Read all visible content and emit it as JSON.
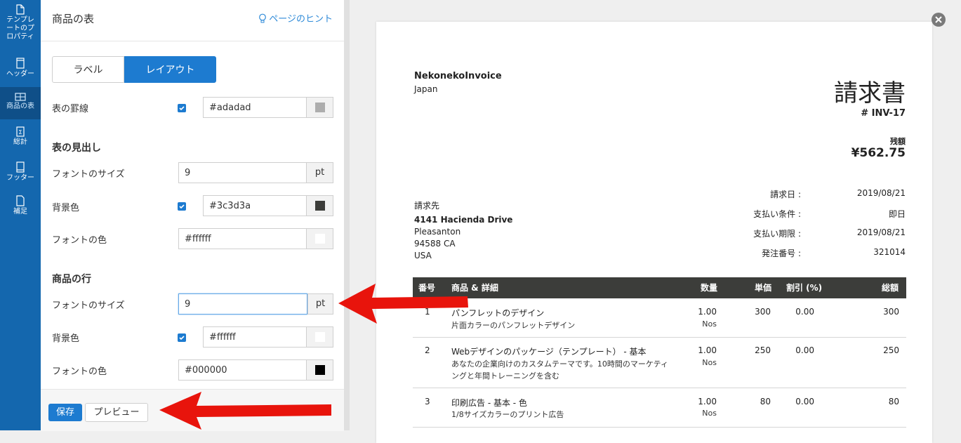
{
  "rail": {
    "items": [
      {
        "label_lines": [
          "テンプレ",
          "ートのプ",
          "ロパティ"
        ]
      },
      {
        "label_lines": [
          "ヘッダー"
        ]
      },
      {
        "label_lines": [
          "商品の表"
        ]
      },
      {
        "label_lines": [
          "総計"
        ]
      },
      {
        "label_lines": [
          "フッター"
        ]
      },
      {
        "label_lines": [
          "補足"
        ]
      }
    ],
    "active_index": 2
  },
  "panel": {
    "title": "商品の表",
    "hint": "ページのヒント",
    "tabs": [
      "ラベル",
      "レイアウト"
    ],
    "active_tab": "レイアウト",
    "border": {
      "label": "表の罫線",
      "checked": true,
      "color": "#adadad"
    },
    "header_section": {
      "title": "表の見出し",
      "font_size_label": "フォントのサイズ",
      "font_size": "9",
      "unit": "pt",
      "bg_label": "背景色",
      "bg_checked": true,
      "bg_color": "#3c3d3a",
      "font_color_label": "フォントの色",
      "font_color": "#ffffff"
    },
    "row_section": {
      "title": "商品の行",
      "font_size_label": "フォントのサイズ",
      "font_size": "9",
      "unit": "pt",
      "bg_label": "背景色",
      "bg_checked": true,
      "bg_color": "#ffffff",
      "font_color_label": "フォントの色",
      "font_color": "#000000"
    },
    "footer": {
      "save": "保存",
      "preview": "プレビュー"
    }
  },
  "invoice": {
    "company": "NekonekoInvoice",
    "country": "Japan",
    "doc_title": "請求書",
    "number": "# INV-17",
    "balance_label": "残額",
    "balance": "¥562.75",
    "bill_to_label": "請求先",
    "bill_to": {
      "line1": "4141 Hacienda Drive",
      "line2": "Pleasanton",
      "line3": "94588 CA",
      "line4": "USA"
    },
    "meta": [
      {
        "label": "請求日 :",
        "value": "2019/08/21"
      },
      {
        "label": "支払い条件 :",
        "value": "即日"
      },
      {
        "label": "支払い期限 :",
        "value": "2019/08/21"
      },
      {
        "label": "発注番号 :",
        "value": "321014"
      }
    ],
    "table": {
      "headers": {
        "no": "番号",
        "item": "商品 & 詳細",
        "qty": "数量",
        "price": "単価",
        "discount": "割引 (%)",
        "total": "総額"
      },
      "rows": [
        {
          "no": "1",
          "name": "パンフレットのデザイン",
          "desc": [
            "片面カラーのパンフレットデザイン"
          ],
          "qty": "1.00",
          "unit": "Nos",
          "price": "300",
          "discount": "0.00",
          "total": "300"
        },
        {
          "no": "2",
          "name": "Webデザインのパッケージ（テンプレート） - 基本",
          "desc": [
            "あなたの企業向けのカスタムテーマです。10時間のマーケティ",
            "ングと年間トレーニングを含む"
          ],
          "qty": "1.00",
          "unit": "Nos",
          "price": "250",
          "discount": "0.00",
          "total": "250"
        },
        {
          "no": "3",
          "name": "印刷広告 - 基本 - 色",
          "desc": [
            "1/8サイズカラーのプリント広告"
          ],
          "qty": "1.00",
          "unit": "Nos",
          "price": "80",
          "discount": "0.00",
          "total": "80"
        }
      ]
    }
  },
  "colors": {
    "accent": "#1d7bd0",
    "rail": "#1467ae",
    "arrow": "#e8140c"
  }
}
